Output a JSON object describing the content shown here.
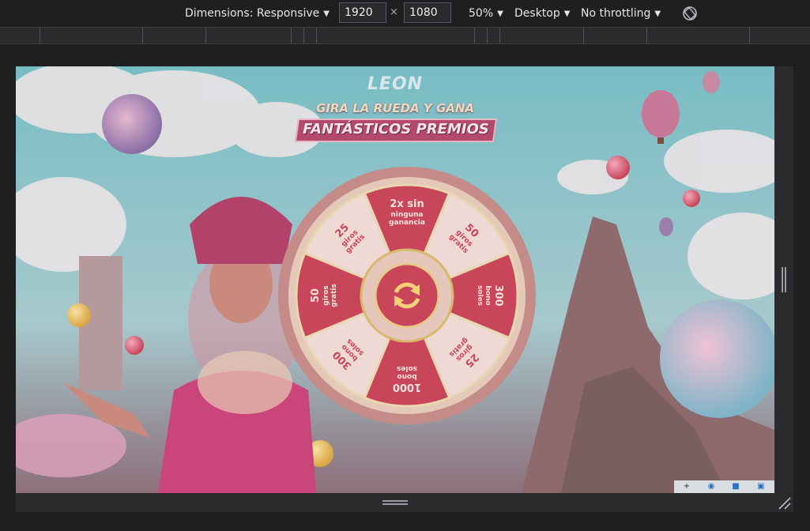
{
  "devtools": {
    "dimensions_label": "Dimensions: Responsive",
    "width_value": "1920",
    "height_value": "1080",
    "times_sign": "×",
    "zoom": "50%",
    "device_type": "Desktop",
    "throttling": "No throttling",
    "rotate_icon": "rotate-icon",
    "caret": "▼"
  },
  "page": {
    "logo": "LEON",
    "subtitle": "GIRA LA RUEDA Y GANA",
    "headline": "FANTÁSTICOS PREMIOS"
  },
  "wheel": {
    "segments": [
      {
        "big": "2x sin",
        "small1": "ninguna",
        "small2": "ganancia",
        "color": "#c9455a"
      },
      {
        "big": "50",
        "small1": "giros",
        "small2": "gratis",
        "color": "#efd9d4"
      },
      {
        "big": "300",
        "small1": "bono",
        "small2": "soles",
        "color": "#c9455a"
      },
      {
        "big": "25",
        "small1": "giros",
        "small2": "gratis",
        "color": "#efd9d4"
      },
      {
        "big": "1000",
        "small1": "bono",
        "small2": "soles",
        "color": "#c9455a"
      },
      {
        "big": "300",
        "small1": "bono",
        "small2": "soles",
        "color": "#efd9d4"
      },
      {
        "big": "50",
        "small1": "giros",
        "small2": "gratis",
        "color": "#c9455a"
      },
      {
        "big": "25",
        "small1": "giros",
        "small2": "gratis",
        "color": "#efd9d4"
      }
    ],
    "spin_icon": "spin-arrows-icon"
  },
  "statusbar": {
    "items": [
      {
        "icon": "plus-icon",
        "glyph": "+"
      },
      {
        "icon": "eye-icon",
        "glyph": "◉"
      },
      {
        "icon": "lock-icon",
        "glyph": "■"
      },
      {
        "icon": "window-icon",
        "glyph": "▣"
      }
    ]
  },
  "colors": {
    "wheel_red": "#c9455a",
    "wheel_cream": "#efd9d4",
    "ribbon": "#b34a6b",
    "sky": "#6fb8c2"
  }
}
